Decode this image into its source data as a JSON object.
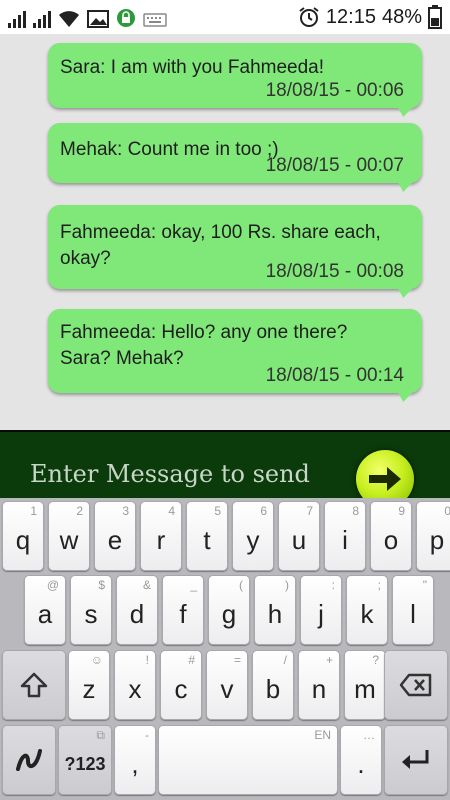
{
  "status_bar": {
    "time": "12:15",
    "battery_percent": "48%"
  },
  "messages": [
    {
      "text": "Sara: I am with you Fahmeeda!",
      "timestamp": "18/08/15 - 00:06"
    },
    {
      "text": "Mehak: Count me in too ;)",
      "timestamp": "18/08/15 - 00:07"
    },
    {
      "text": "Fahmeeda: okay, 100 Rs. share each, okay?",
      "timestamp": "18/08/15 - 00:08"
    },
    {
      "text": "Fahmeeda: Hello? any one there? Sara? Mehak?",
      "timestamp": "18/08/15 - 00:14"
    }
  ],
  "composer": {
    "placeholder": "Enter Message to send"
  },
  "keyboard": {
    "row1": [
      {
        "k": "q",
        "h": "1"
      },
      {
        "k": "w",
        "h": "2"
      },
      {
        "k": "e",
        "h": "3"
      },
      {
        "k": "r",
        "h": "4"
      },
      {
        "k": "t",
        "h": "5"
      },
      {
        "k": "y",
        "h": "6"
      },
      {
        "k": "u",
        "h": "7"
      },
      {
        "k": "i",
        "h": "8"
      },
      {
        "k": "o",
        "h": "9"
      },
      {
        "k": "p",
        "h": "0"
      }
    ],
    "row2": [
      {
        "k": "a",
        "h": "@"
      },
      {
        "k": "s",
        "h": "$"
      },
      {
        "k": "d",
        "h": "&"
      },
      {
        "k": "f",
        "h": "_"
      },
      {
        "k": "g",
        "h": "("
      },
      {
        "k": "h",
        "h": ")"
      },
      {
        "k": "j",
        "h": ":"
      },
      {
        "k": "k",
        "h": ";"
      },
      {
        "k": "l",
        "h": "\""
      }
    ],
    "row3": [
      {
        "k": "z",
        "h": "☺"
      },
      {
        "k": "x",
        "h": "!"
      },
      {
        "k": "c",
        "h": "#"
      },
      {
        "k": "v",
        "h": "="
      },
      {
        "k": "b",
        "h": "/"
      },
      {
        "k": "n",
        "h": "+"
      },
      {
        "k": "m",
        "h": "?"
      }
    ],
    "symbols_label": "?123",
    "comma_label": ",",
    "comma_hint": "-",
    "space_hint": "EN",
    "period_label": ".",
    "period_hint": "…"
  }
}
